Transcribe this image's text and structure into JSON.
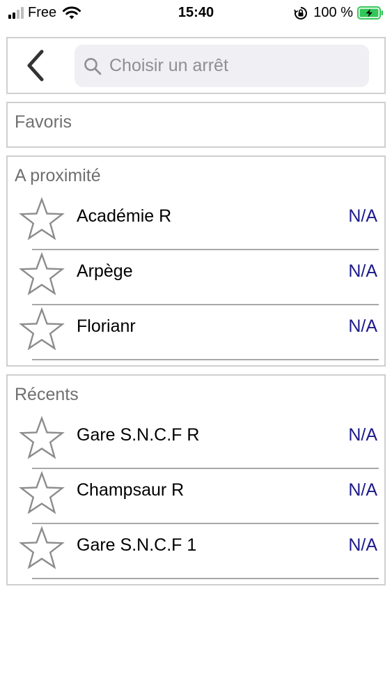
{
  "status_bar": {
    "carrier": "Free",
    "time": "15:40",
    "battery_percent": "100 %",
    "battery_color": "#34c759"
  },
  "header": {
    "back_icon": "chevron-left-icon",
    "search_placeholder": "Choisir un arrêt"
  },
  "favorites": {
    "title": "Favoris"
  },
  "nearby": {
    "title": "A proximité",
    "items": [
      {
        "name": "Académie R",
        "value": "N/A"
      },
      {
        "name": "Arpège",
        "value": "N/A"
      },
      {
        "name": "Florianr",
        "value": "N/A"
      }
    ]
  },
  "recents": {
    "title": "Récents",
    "items": [
      {
        "name": "Gare S.N.C.F R",
        "value": "N/A"
      },
      {
        "name": "Champsaur R",
        "value": "N/A"
      },
      {
        "name": "Gare S.N.C.F 1",
        "value": "N/A"
      }
    ]
  },
  "colors": {
    "value_text": "#1c1a8a",
    "section_border": "#cfcfcf",
    "search_bg": "#efeff4"
  }
}
